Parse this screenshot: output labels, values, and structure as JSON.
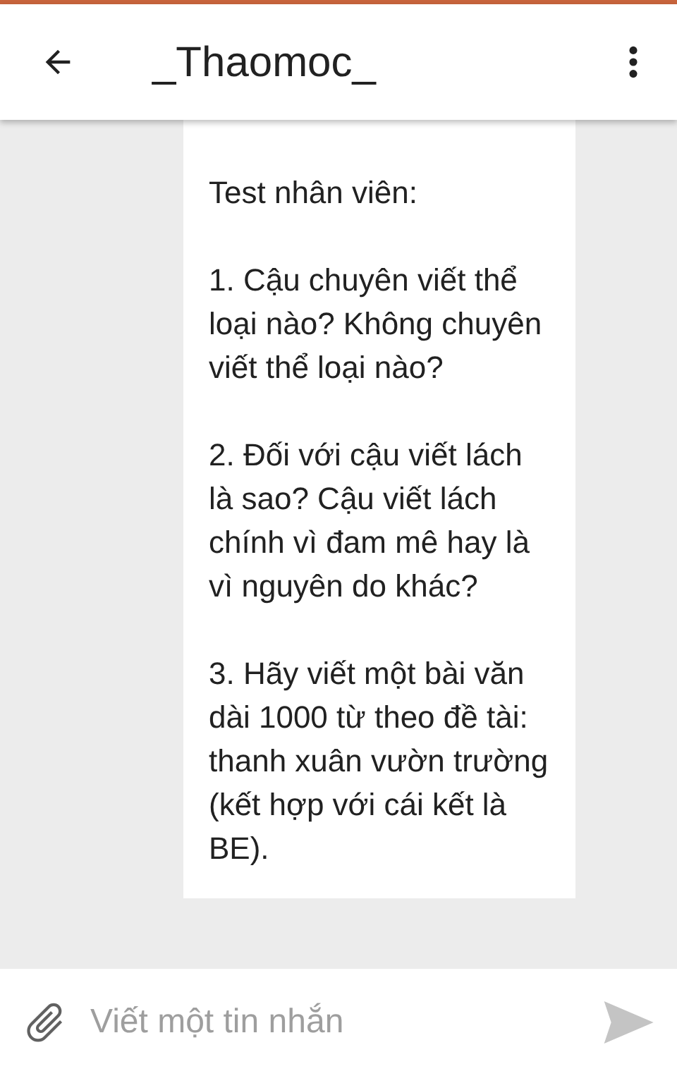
{
  "header": {
    "title": "_Thaomoc_"
  },
  "message": {
    "paragraphs": [
      "Test nhân viên:",
      "1. Cậu chuyên viết thể loại nào? Không chuyên viết thể loại nào?",
      "2. Đối với cậu viết lách là sao? Cậu viết lách chính vì đam mê hay là vì nguyên do khác?",
      "3. Hãy viết một bài văn dài 1000 từ theo đề tài: thanh xuân vườn trường (kết hợp với cái kết là BE)."
    ]
  },
  "composer": {
    "placeholder": "Viết một tin nhắn"
  }
}
